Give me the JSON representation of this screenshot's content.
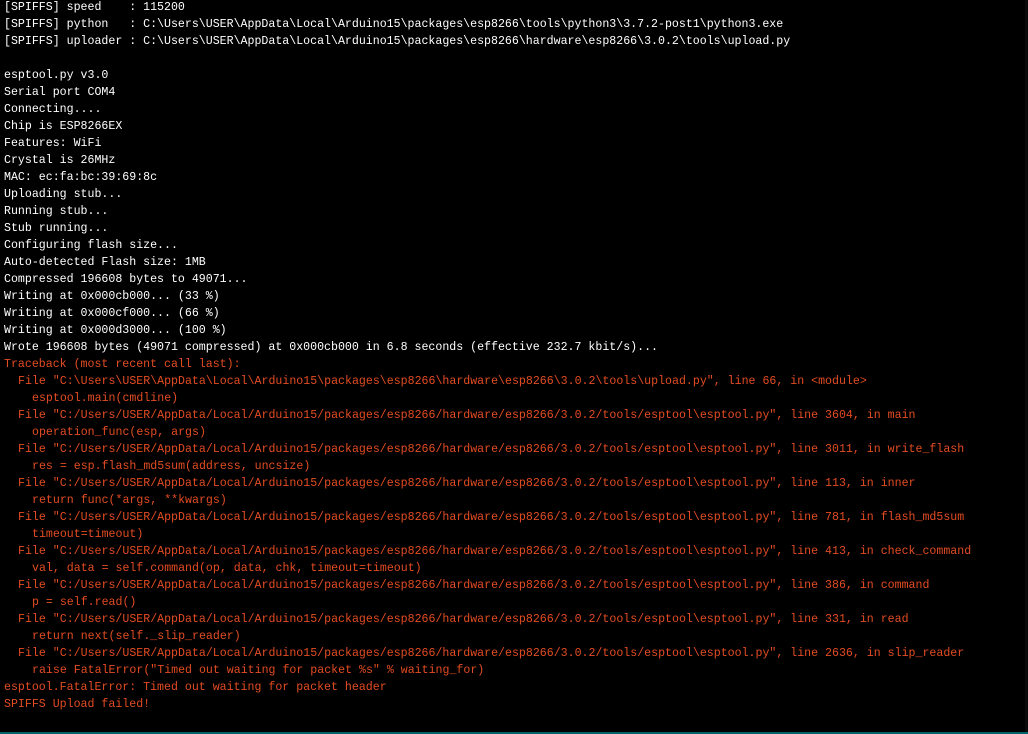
{
  "console": {
    "header": [
      "[SPIFFS] speed    : 115200",
      "[SPIFFS] python   : C:\\Users\\USER\\AppData\\Local\\Arduino15\\packages\\esp8266\\tools\\python3\\3.7.2-post1\\python3.exe",
      "[SPIFFS] uploader : C:\\Users\\USER\\AppData\\Local\\Arduino15\\packages\\esp8266\\hardware\\esp8266\\3.0.2\\tools\\upload.py"
    ],
    "output": [
      "esptool.py v3.0",
      "Serial port COM4",
      "Connecting....",
      "Chip is ESP8266EX",
      "Features: WiFi",
      "Crystal is 26MHz",
      "MAC: ec:fa:bc:39:69:8c",
      "Uploading stub...",
      "Running stub...",
      "Stub running...",
      "Configuring flash size...",
      "Auto-detected Flash size: 1MB",
      "Compressed 196608 bytes to 49071...",
      "Writing at 0x000cb000... (33 %)",
      "Writing at 0x000cf000... (66 %)",
      "Writing at 0x000d3000... (100 %)",
      "Wrote 196608 bytes (49071 compressed) at 0x000cb000 in 6.8 seconds (effective 232.7 kbit/s)..."
    ],
    "traceback_title": "Traceback (most recent call last):",
    "traceback": [
      {
        "file": "File \"C:\\Users\\USER\\AppData\\Local\\Arduino15\\packages\\esp8266\\hardware\\esp8266\\3.0.2\\tools\\upload.py\", line 66, in <module>",
        "code": "esptool.main(cmdline)"
      },
      {
        "file": "File \"C:/Users/USER/AppData/Local/Arduino15/packages/esp8266/hardware/esp8266/3.0.2/tools/esptool\\esptool.py\", line 3604, in main",
        "code": "operation_func(esp, args)"
      },
      {
        "file": "File \"C:/Users/USER/AppData/Local/Arduino15/packages/esp8266/hardware/esp8266/3.0.2/tools/esptool\\esptool.py\", line 3011, in write_flash",
        "code": "res = esp.flash_md5sum(address, uncsize)"
      },
      {
        "file": "File \"C:/Users/USER/AppData/Local/Arduino15/packages/esp8266/hardware/esp8266/3.0.2/tools/esptool\\esptool.py\", line 113, in inner",
        "code": "return func(*args, **kwargs)"
      },
      {
        "file": "File \"C:/Users/USER/AppData/Local/Arduino15/packages/esp8266/hardware/esp8266/3.0.2/tools/esptool\\esptool.py\", line 781, in flash_md5sum",
        "code": "timeout=timeout)"
      },
      {
        "file": "File \"C:/Users/USER/AppData/Local/Arduino15/packages/esp8266/hardware/esp8266/3.0.2/tools/esptool\\esptool.py\", line 413, in check_command",
        "code": "val, data = self.command(op, data, chk, timeout=timeout)"
      },
      {
        "file": "File \"C:/Users/USER/AppData/Local/Arduino15/packages/esp8266/hardware/esp8266/3.0.2/tools/esptool\\esptool.py\", line 386, in command",
        "code": "p = self.read()"
      },
      {
        "file": "File \"C:/Users/USER/AppData/Local/Arduino15/packages/esp8266/hardware/esp8266/3.0.2/tools/esptool\\esptool.py\", line 331, in read",
        "code": "return next(self._slip_reader)"
      },
      {
        "file": "File \"C:/Users/USER/AppData/Local/Arduino15/packages/esp8266/hardware/esp8266/3.0.2/tools/esptool\\esptool.py\", line 2636, in slip_reader",
        "code": "raise FatalError(\"Timed out waiting for packet %s\" % waiting_for)"
      }
    ],
    "fatal_error": "esptool.FatalError: Timed out waiting for packet header",
    "failure_message": "SPIFFS Upload failed!",
    "colors": {
      "background": "#000000",
      "normal_text": "#ffffff",
      "error_text": "#e34c22",
      "bottom_border": "#006468"
    }
  }
}
